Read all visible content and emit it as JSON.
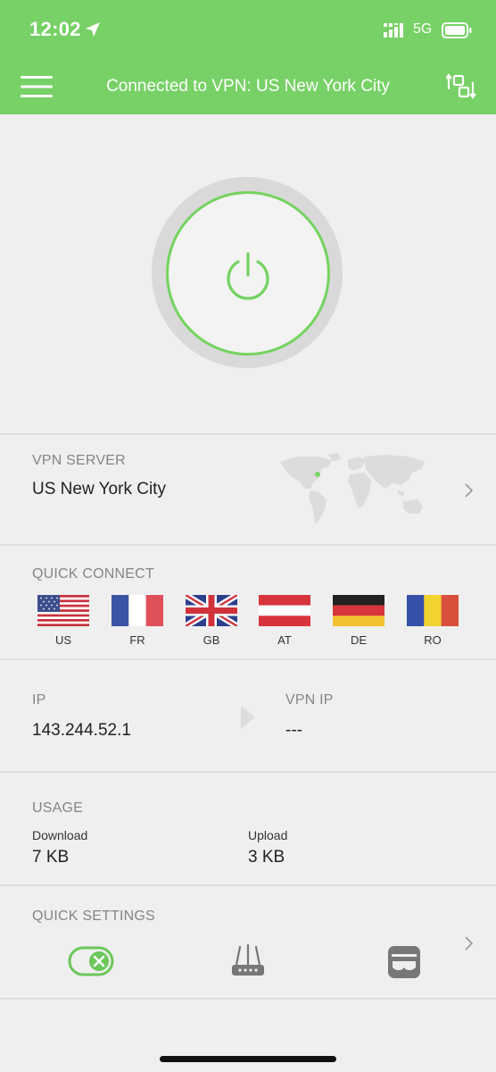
{
  "status_bar": {
    "time": "12:02",
    "network": "5G"
  },
  "header": {
    "title": "Connected to VPN: US New York City"
  },
  "server": {
    "section_label": "VPN SERVER",
    "value": "US New York City"
  },
  "quick_connect": {
    "section_label": "QUICK CONNECT",
    "countries": [
      {
        "code": "US"
      },
      {
        "code": "FR"
      },
      {
        "code": "GB"
      },
      {
        "code": "AT"
      },
      {
        "code": "DE"
      },
      {
        "code": "RO"
      }
    ]
  },
  "ip": {
    "ip_label": "IP",
    "ip_value": "143.244.52.1",
    "vpn_ip_label": "VPN IP",
    "vpn_ip_value": "---"
  },
  "usage": {
    "section_label": "USAGE",
    "download_label": "Download",
    "download_value": "7 KB",
    "upload_label": "Upload",
    "upload_value": "3 KB"
  },
  "quick_settings": {
    "section_label": "QUICK SETTINGS",
    "icons": [
      "kill-switch-toggle-icon",
      "router-icon",
      "mask-icon"
    ]
  },
  "colors": {
    "accent": "#77d166",
    "ring": "#74d35f",
    "background": "#efefef"
  }
}
